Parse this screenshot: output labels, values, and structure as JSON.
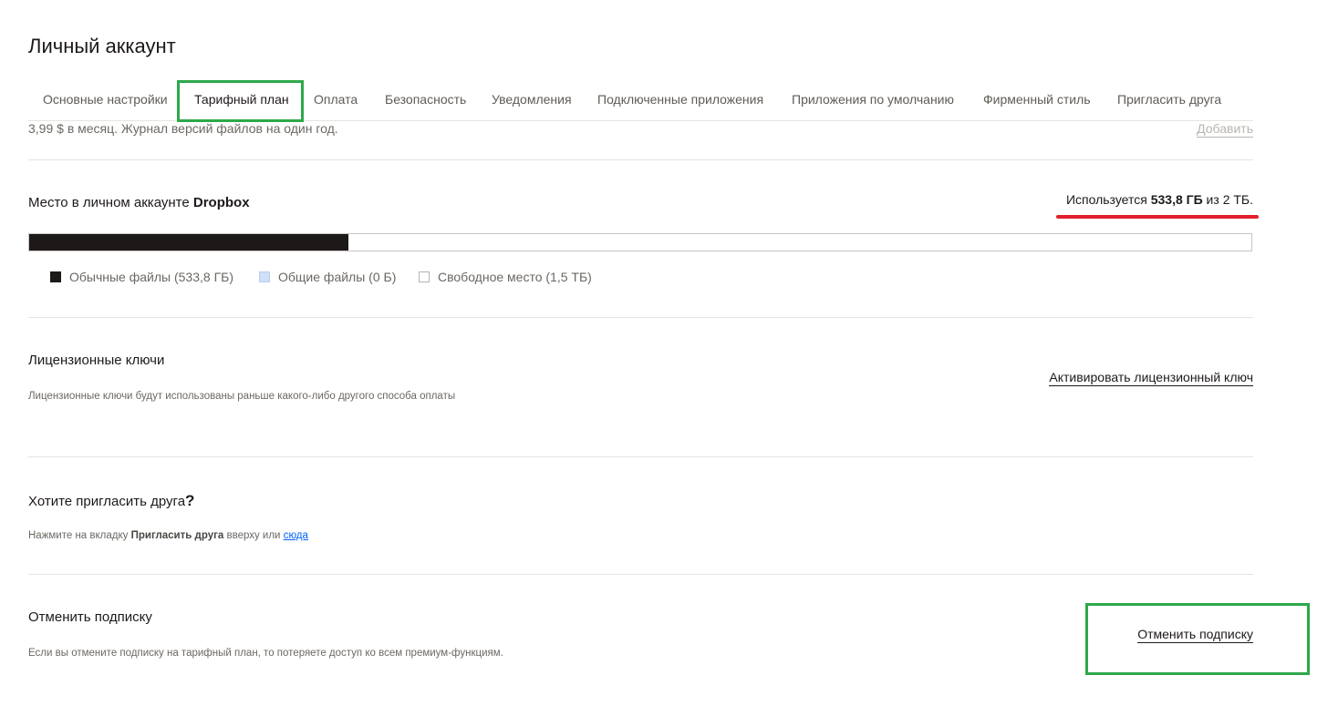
{
  "page": {
    "title": "Личный аккаунт"
  },
  "tabs": [
    {
      "label": "Основные настройки"
    },
    {
      "label": "Тарифный план",
      "active": true
    },
    {
      "label": "Оплата"
    },
    {
      "label": "Безопасность"
    },
    {
      "label": "Уведомления"
    },
    {
      "label": "Подключенные приложения"
    },
    {
      "label": "Приложения по умолчанию"
    },
    {
      "label": "Фирменный стиль"
    },
    {
      "label": "Пригласить друга"
    }
  ],
  "plan_row": {
    "text": "3,99 $ в месяц. Журнал версий файлов на один год.",
    "action": "Добавить"
  },
  "storage": {
    "title_prefix": "Место в личном аккаунте ",
    "title_brand": "Dropbox",
    "usage_prefix": "Используется ",
    "usage_used": "533,8 ГБ",
    "usage_mid": " из ",
    "usage_total": "2 ТБ.",
    "used_fraction": 0.261,
    "legend": [
      {
        "label": "Обычные файлы (533,8 ГБ)",
        "color": "#1e1919"
      },
      {
        "label": "Общие файлы (0 Б)",
        "color": "#cfe0fb"
      },
      {
        "label": "Свободное место (1,5 ТБ)",
        "color": "#ffffff"
      }
    ]
  },
  "license": {
    "title": "Лицензионные ключи",
    "description": "Лицензионные ключи будут использованы раньше какого-либо другого способа оплаты",
    "action": "Активировать лицензионный ключ"
  },
  "invite": {
    "title": "Хотите пригласить друга",
    "title_mark": "?",
    "desc_prefix": "Нажмите на вкладку ",
    "desc_bold": "Пригласить друга",
    "desc_mid": " вверху или ",
    "desc_link": "сюда"
  },
  "cancel": {
    "title": "Отменить подписку",
    "description": "Если вы отмените подписку на тарифный план, то потеряете доступ ко всем премиум-функциям.",
    "action": "Отменить подписку"
  },
  "colors": {
    "highlight_green": "#2ea84a",
    "underline_red": "#e0202c",
    "link_blue": "#0061fe"
  }
}
